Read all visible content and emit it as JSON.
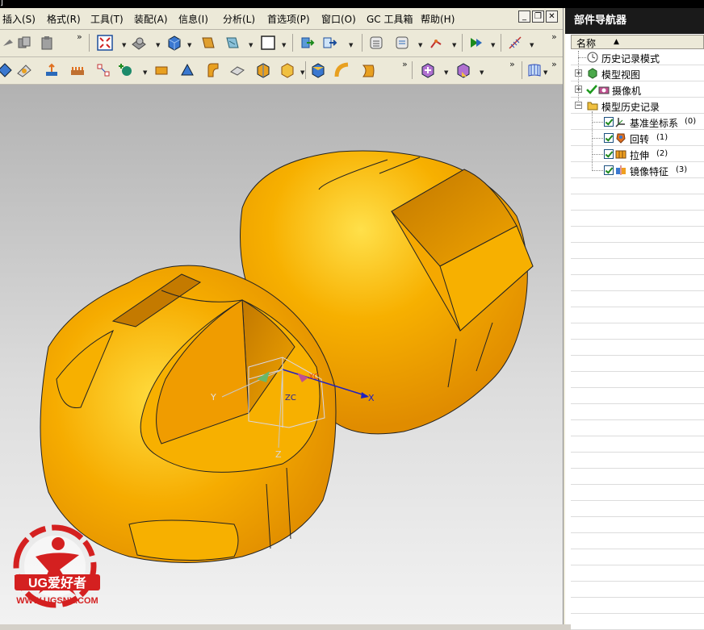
{
  "menubar": {
    "items": [
      "插入(S)",
      "格式(R)",
      "工具(T)",
      "装配(A)",
      "信息(I)",
      "分析(L)",
      "首选项(P)",
      "窗口(O)",
      "GC 工具箱",
      "帮助(H)"
    ]
  },
  "window_controls": {
    "minimize": "_",
    "restore": "❐",
    "close": "✕"
  },
  "toolbar": {
    "overflow": "»"
  },
  "navigator": {
    "title": "部件导航器",
    "column_header": "名称",
    "sort_indicator": "▲",
    "nodes": [
      {
        "label": "历史记录模式",
        "icon": "clock-icon"
      },
      {
        "label": "模型视图",
        "icon": "model-views-icon",
        "expander": "+"
      },
      {
        "label": "摄像机",
        "icon": "camera-icon",
        "expander": "+"
      },
      {
        "label": "模型历史记录",
        "icon": "folder-icon",
        "expander": "−"
      }
    ],
    "features": [
      {
        "label": "基准坐标系",
        "index": "(0)",
        "icon": "datum-csys-icon"
      },
      {
        "label": "回转",
        "index": "(1)",
        "icon": "revolve-icon"
      },
      {
        "label": "拉伸",
        "index": "(2)",
        "icon": "extrude-icon"
      },
      {
        "label": "镜像特征",
        "index": "(3)",
        "icon": "mirror-feature-icon"
      }
    ]
  },
  "viewport": {
    "triad_labels": {
      "x": "X",
      "y": "Y",
      "z": "Z",
      "xc": "XC",
      "zc": "ZC"
    },
    "model_color": "#f5a800",
    "background_top": "#b2b2b2",
    "background_bottom": "#f2f2f2"
  },
  "watermark": {
    "brand": "UG爱好者",
    "url": "WWW.UGSNX.COM",
    "color": "#d42020"
  }
}
